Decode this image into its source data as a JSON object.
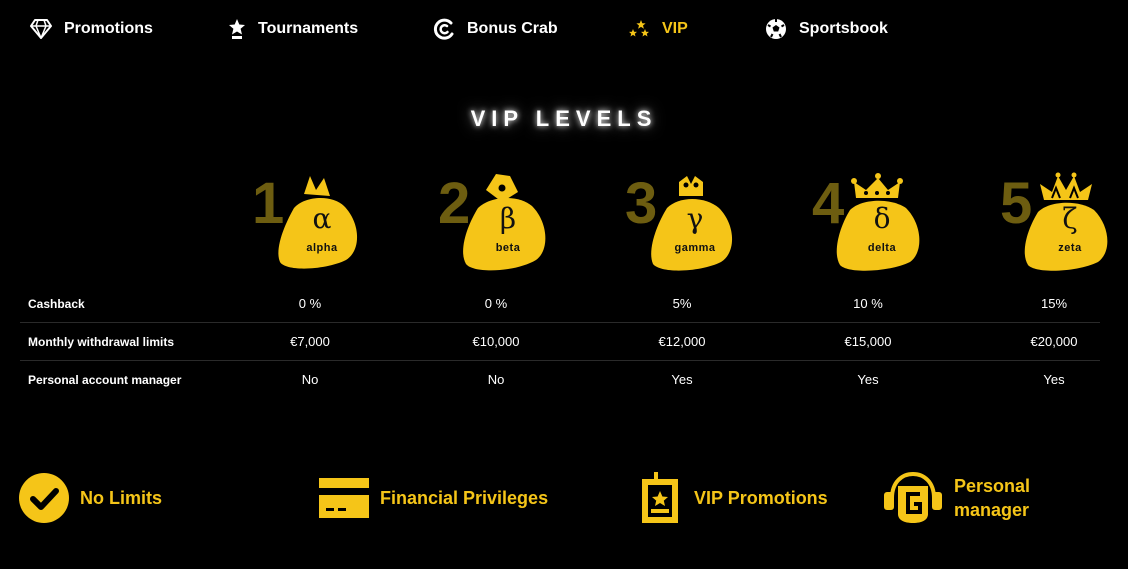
{
  "nav": {
    "items": [
      {
        "label": "Promotions",
        "icon": "diamond-icon"
      },
      {
        "label": "Tournaments",
        "icon": "star-trophy-icon"
      },
      {
        "label": "Bonus Crab",
        "icon": "bonus-crab-icon"
      },
      {
        "label": "VIP",
        "icon": "stars-icon",
        "active": true
      },
      {
        "label": "Sportsbook",
        "icon": "soccer-ball-icon"
      }
    ]
  },
  "title": "VIP LEVELS",
  "levels": [
    {
      "number": "1",
      "symbol": "α",
      "name": "alpha"
    },
    {
      "number": "2",
      "symbol": "β",
      "name": "beta"
    },
    {
      "number": "3",
      "symbol": "γ",
      "name": "gamma"
    },
    {
      "number": "4",
      "symbol": "δ",
      "name": "delta"
    },
    {
      "number": "5",
      "symbol": "ζ",
      "name": "zeta"
    }
  ],
  "table": {
    "rows": [
      {
        "label": "Cashback",
        "values": [
          "0 %",
          "0 %",
          "5%",
          "10 %",
          "15%"
        ]
      },
      {
        "label": "Monthly withdrawal limits",
        "values": [
          "€7,000",
          "€10,000",
          "€12,000",
          "€15,000",
          "€20,000"
        ]
      },
      {
        "label": "Personal account manager",
        "values": [
          "No",
          "No",
          "Yes",
          "Yes",
          "Yes"
        ]
      }
    ]
  },
  "features": [
    {
      "label": "No Limits",
      "icon": "check-circle-icon"
    },
    {
      "label": "Financial Privileges",
      "icon": "credit-card-icon"
    },
    {
      "label": "VIP Promotions",
      "icon": "badge-star-icon"
    },
    {
      "label_line1": "Personal",
      "label_line2": "manager",
      "icon": "headset-manager-icon"
    }
  ],
  "colors": {
    "accent": "#f5c518",
    "background": "#000000",
    "level_number": "#6d5d10"
  }
}
